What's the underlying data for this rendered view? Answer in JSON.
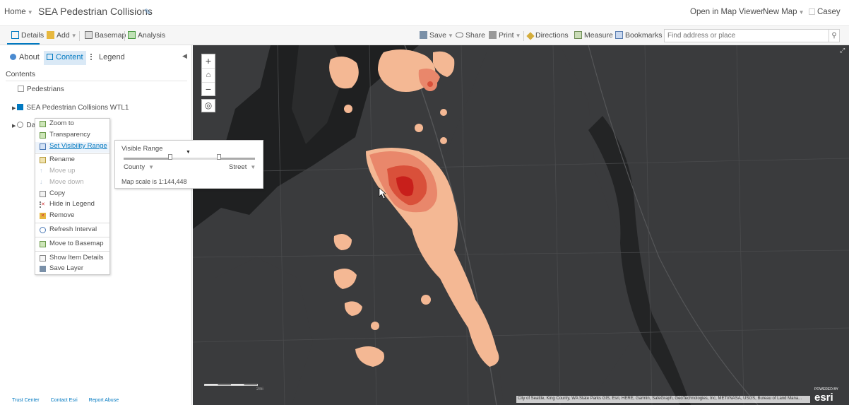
{
  "header": {
    "home": "Home",
    "title": "SEA Pedestrian Collisions",
    "open_map_viewer": "Open in Map Viewer",
    "new_map": "New Map",
    "user": "Casey"
  },
  "toolbar": {
    "details": "Details",
    "add": "Add",
    "basemap": "Basemap",
    "analysis": "Analysis",
    "save": "Save",
    "share": "Share",
    "print": "Print",
    "directions": "Directions",
    "measure": "Measure",
    "bookmarks": "Bookmarks",
    "search_placeholder": "Find address or place"
  },
  "sidebar": {
    "tabs": [
      {
        "label": "About"
      },
      {
        "label": "Content"
      },
      {
        "label": "Legend"
      }
    ],
    "contents_label": "Contents",
    "layers": [
      {
        "label": "Pedestrians",
        "checked": false
      },
      {
        "label": "SEA Pedestrian Collisions WTL1",
        "checked": true
      },
      {
        "label": "Da",
        "checked": false
      }
    ],
    "footer": [
      "Trust Center",
      "Contact Esri",
      "Report Abuse"
    ]
  },
  "context_menu": {
    "items": [
      {
        "label": "Zoom to"
      },
      {
        "label": "Transparency"
      },
      {
        "label": "Set Visibility Range"
      },
      {
        "label": "Rename"
      },
      {
        "label": "Move up"
      },
      {
        "label": "Move down"
      },
      {
        "label": "Copy"
      },
      {
        "label": "Hide in Legend"
      },
      {
        "label": "Remove"
      },
      {
        "label": "Refresh Interval"
      },
      {
        "label": "Move to Basemap"
      },
      {
        "label": "Show Item Details"
      },
      {
        "label": "Save Layer"
      }
    ]
  },
  "visible_range": {
    "title": "Visible Range",
    "min_label": "County",
    "max_label": "Street",
    "scale_text": "Map scale is 1:144,448"
  },
  "map": {
    "scalebar_label": "2mi",
    "attribution": "City of Seattle, King County, WA State Parks GIS, Esri, HERE, Garmin, SafeGraph, GeoTechnologies, Inc, METI/NASA, USGS, Bureau of Land Mana...",
    "esri_logo": "esri",
    "powered_by": "POWERED BY",
    "colors": {
      "background": "#353638",
      "heat_low": "#f4b894",
      "heat_mid": "#e9876b",
      "heat_high": "#d9503a",
      "heat_peak": "#c81f1b"
    }
  }
}
